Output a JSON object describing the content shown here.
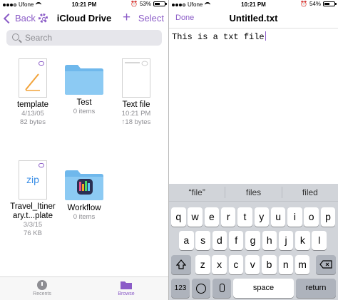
{
  "left": {
    "status": {
      "carrier": "Ufone",
      "time": "10:21 PM",
      "battery": "53%",
      "battery_level": 0.53
    },
    "nav": {
      "back": "Back",
      "title": "iCloud Drive",
      "plus": "+",
      "select": "Select"
    },
    "search": {
      "placeholder": "Search"
    },
    "files": [
      {
        "name": "template",
        "line1": "4/13/05",
        "line2": "82 bytes"
      },
      {
        "name": "Test",
        "line1": "0 items",
        "line2": ""
      },
      {
        "name": "Text file",
        "line1": "10:21 PM",
        "line2": "↑18 bytes"
      },
      {
        "name": "Travel_Itiner",
        "name2": "ary.t...plate",
        "line1": "3/3/15",
        "line2": "76 KB"
      },
      {
        "name": "Workflow",
        "line1": "0 items",
        "line2": ""
      }
    ],
    "zip_label": "zip",
    "tabs": [
      {
        "label": "Recents"
      },
      {
        "label": "Browse"
      }
    ]
  },
  "right": {
    "status": {
      "carrier": "Ufone",
      "time": "10:21 PM",
      "battery": "54%",
      "battery_level": 0.54
    },
    "nav": {
      "done": "Done",
      "title": "Untitled.txt"
    },
    "content": "This is a txt file",
    "keyboard": {
      "suggestions": [
        "“file”",
        "files",
        "filed"
      ],
      "row1": [
        "q",
        "w",
        "e",
        "r",
        "t",
        "y",
        "u",
        "i",
        "o",
        "p"
      ],
      "row2": [
        "a",
        "s",
        "d",
        "f",
        "g",
        "h",
        "j",
        "k",
        "l"
      ],
      "row3": [
        "z",
        "x",
        "c",
        "v",
        "b",
        "n",
        "m"
      ],
      "numbers": "123",
      "space": "space",
      "return": "return",
      "shift_icon": "shift-icon",
      "delete_icon": "delete-icon",
      "emoji_icon": "emoji-icon",
      "mic_icon": "mic-icon"
    }
  },
  "colors": {
    "accent": "#8b5cc7",
    "folder": "#6fb8ec",
    "keyboard_bg": "#d1d4d9"
  }
}
